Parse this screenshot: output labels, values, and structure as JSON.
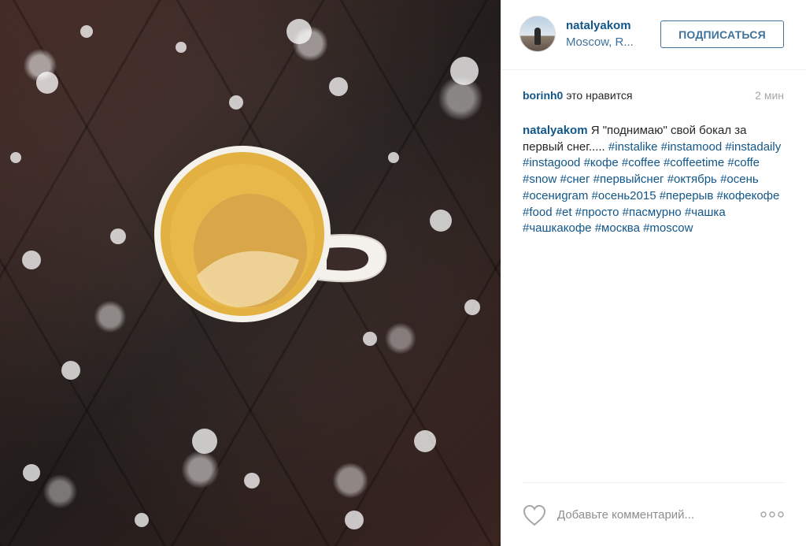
{
  "post": {
    "photo_icon": "coffee-cup-photo",
    "header": {
      "username": "natalyakom",
      "location": "Moscow, R...",
      "follow_label": "ПОДПИСАТЬСЯ"
    },
    "likes": {
      "liker": "borinh0",
      "text": "это нравится",
      "time": "2 мин"
    },
    "caption": {
      "username": "natalyakom",
      "text": "Я \"поднимаю\" свой бокал за первый снег.....",
      "hashtags": [
        "#instalike",
        "#instamood",
        "#instadaily",
        "#instagood",
        "#кофе",
        "#coffee",
        "#coffeetime",
        "#coffe",
        "#snow",
        "#снег",
        "#первыйснег",
        "#октябрь",
        "#осень",
        "#осениgram",
        "#осень2015",
        "#перерыв",
        "#кофекофе",
        "#food",
        "#et",
        "#просто",
        "#пасмурно",
        "#чашка",
        "#чашкакофе",
        "#москва",
        "#moscow"
      ]
    },
    "actions": {
      "like_icon": "heart-icon",
      "comment_placeholder": "Добавьте комментарий...",
      "more_icon": "more-icon"
    }
  },
  "colors": {
    "link": "#125688",
    "location": "#3f729b",
    "button": "#3f729b",
    "muted": "#a5a7aa",
    "divider": "#efefef"
  }
}
